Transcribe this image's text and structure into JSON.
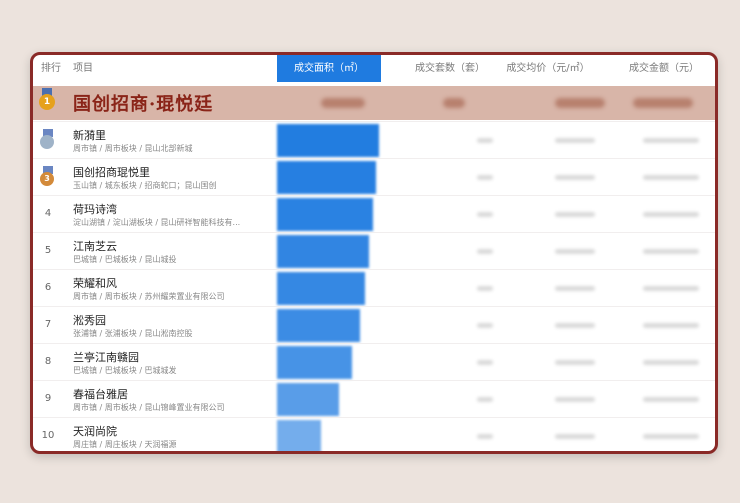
{
  "header": {
    "rank": "排行",
    "project": "项目",
    "area": "成交面积（㎡）",
    "units": "成交套数（套）",
    "price": "成交均价（元/㎡）",
    "amount": "成交金额（元）"
  },
  "banner": {
    "medal": "1",
    "title": "国创招商·琨悦廷"
  },
  "rows": [
    {
      "rank": "",
      "medal": "silver",
      "name": "新漪里",
      "sub": "周市镇 / 周市板块 / 昆山北部新城",
      "area_share": 0.98
    },
    {
      "rank": "3",
      "medal": "bronze",
      "name": "国创招商琨悦里",
      "sub": "玉山镇 / 城东板块 / 招商蛇口；昆山国创",
      "area_share": 0.95
    },
    {
      "rank": "4",
      "name": "荷玛诗湾",
      "sub": "淀山湖镇 / 淀山湖板块 / 昆山研祥智能科技有...",
      "area_share": 0.92
    },
    {
      "rank": "5",
      "name": "江南芝云",
      "sub": "巴城镇 / 巴城板块 / 昆山城投",
      "area_share": 0.88
    },
    {
      "rank": "6",
      "name": "荣耀和风",
      "sub": "周市镇 / 周市板块 / 苏州耀荣置业有限公司",
      "area_share": 0.85
    },
    {
      "rank": "7",
      "name": "淞秀园",
      "sub": "张浦镇 / 张浦板块 / 昆山淞南控股",
      "area_share": 0.8
    },
    {
      "rank": "8",
      "name": "兰亭江南赣园",
      "sub": "巴城镇 / 巴城板块 / 巴城城发",
      "area_share": 0.72
    },
    {
      "rank": "9",
      "name": "春福台雅居",
      "sub": "周市镇 / 周市板块 / 昆山锦峰置业有限公司",
      "area_share": 0.6
    },
    {
      "rank": "10",
      "name": "天润尚院",
      "sub": "周庄镇 / 周庄板块 / 天润福源",
      "area_share": 0.42
    }
  ],
  "colors": {
    "accent": "#1f7be0",
    "border": "#8a2a27",
    "banner": "#d8b5a8",
    "gold": "#e6a11c",
    "silver": "#9fb3c8",
    "bronze": "#d38a3a"
  }
}
